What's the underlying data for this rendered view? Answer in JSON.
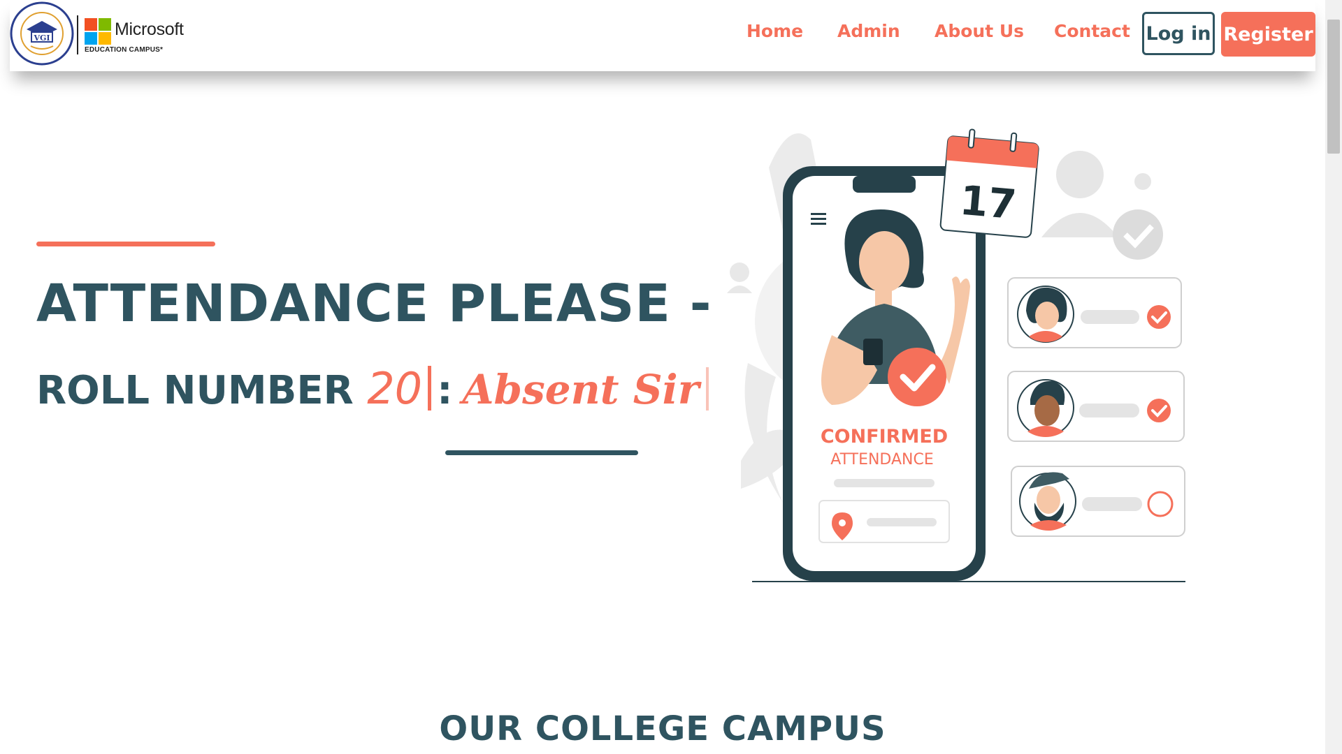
{
  "brand": {
    "seal_text": "VGI",
    "seal_ring_text": "VISHVESHWARYA GROUP OF INSTITUTIONS",
    "microsoft_word": "Microsoft",
    "microsoft_sub": "EDUCATION CAMPUS*",
    "ms_colors": [
      "#f25022",
      "#7fba00",
      "#00a4ef",
      "#ffb900"
    ]
  },
  "nav": {
    "items": [
      {
        "label": "Home"
      },
      {
        "label": "Admin"
      },
      {
        "label": "About Us"
      },
      {
        "label": "Contact"
      }
    ],
    "login_label": "Log in",
    "register_label": "Register"
  },
  "hero": {
    "title": "ATTENDANCE PLEASE -",
    "subtitle_prefix": "ROLL NUMBER",
    "roll_number": "20",
    "separator": ":",
    "typed_text": "Absent Sir"
  },
  "illustration": {
    "calendar_day": "17",
    "confirmed_label": "CONFIRMED",
    "attendance_label": "ATTENDANCE"
  },
  "section": {
    "title": "OUR COLLEGE CAMPUS"
  },
  "colors": {
    "accent": "#f5705a",
    "primary": "#2f5460"
  }
}
